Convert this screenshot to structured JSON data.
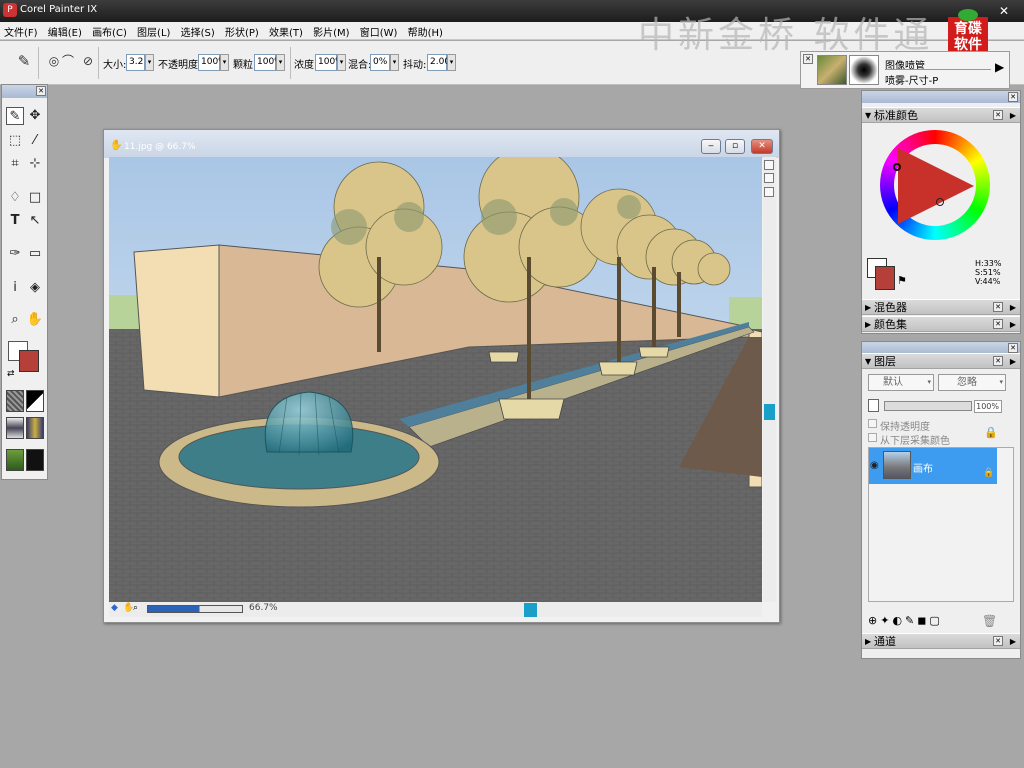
{
  "app": {
    "title": "Corel Painter IX",
    "close_glyph": "✕",
    "watermark": "中新金桥 软件通",
    "logo_text": "育碟\n软件"
  },
  "menu": [
    "文件(F)",
    "编辑(E)",
    "画布(C)",
    "图层(L)",
    "选择(S)",
    "形状(P)",
    "效果(T)",
    "影片(M)",
    "窗口(W)",
    "帮助(H)"
  ],
  "toolbar": {
    "size_label": "大小:",
    "size_value": "3.2",
    "opacity_label": "不透明度:",
    "opacity_value": "100%",
    "grain_label": "颗粒:",
    "grain_value": "100%",
    "density_label": "浓度:",
    "density_value": "100%",
    "mix_label": "混合:",
    "mix_value": "0%",
    "jitter_label": "抖动:",
    "jitter_value": "2.00"
  },
  "brush_selector": {
    "category": "图像喷管",
    "variant": "喷雾-尺寸-P"
  },
  "document": {
    "title": "11.jpg @ 66.7%",
    "zoom": "66.7%"
  },
  "color_panel": {
    "title": "标准颜色",
    "h": "H:33%",
    "s": "S:51%",
    "v": "V:44%",
    "mixer_label": "混色器",
    "color_sets_label": "颜色集",
    "main_color": "#b5403a"
  },
  "layers_panel": {
    "title": "图层",
    "composite_method": "默认",
    "composite_depth": "忽略",
    "opacity": "100%",
    "preserve_transparency": "保持透明度",
    "pick_up_color": "从下层采集颜色",
    "layer_name": "画布",
    "channels_label": "通道"
  }
}
